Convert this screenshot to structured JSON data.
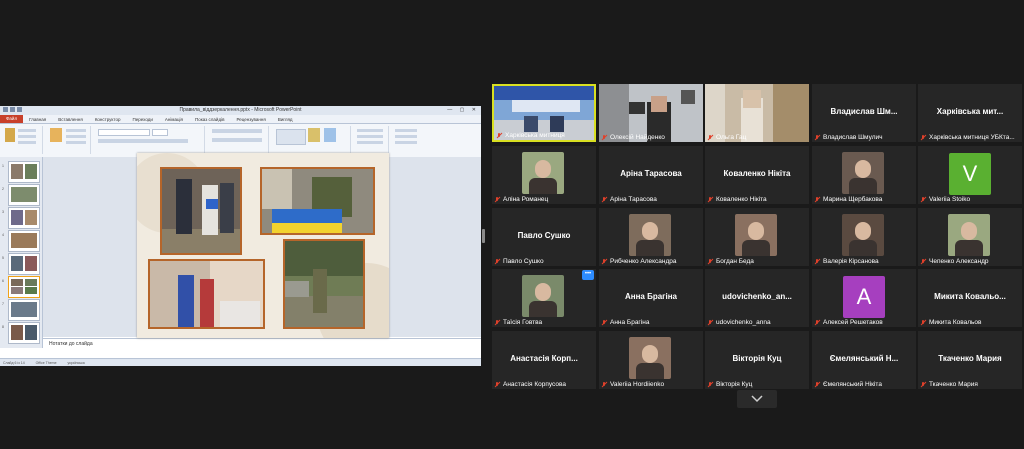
{
  "ppt": {
    "window_title": "Правила_віддзеркалення.pptx - Microsoft PowerPoint",
    "file_tab": "Файл",
    "ribbon_tabs": [
      "Главная",
      "Вставлення",
      "Конструктор",
      "Переходи",
      "Анімація",
      "Показ слайдів",
      "Рецензування",
      "Вигляд"
    ],
    "slide_numbers": [
      "1",
      "2",
      "3",
      "4",
      "5",
      "6",
      "7",
      "8"
    ],
    "notes_placeholder": "Нотатки до слайда",
    "status": [
      "Слайд 6 із 14",
      "Office Theme",
      "українська"
    ]
  },
  "participants": [
    {
      "id": "p1",
      "name": "Харківська митниця",
      "big": "",
      "kind": "video",
      "active": true
    },
    {
      "id": "p2",
      "name": "Олексій Найденко",
      "big": "",
      "kind": "video"
    },
    {
      "id": "p3",
      "name": "Ольга Гац",
      "big": "",
      "kind": "video"
    },
    {
      "id": "p4",
      "name": "Владислав Шмулич",
      "big": "Владислав Шм...",
      "kind": "text"
    },
    {
      "id": "p5",
      "name": "Харківська митниця УБКта...",
      "big": "Харківська мит...",
      "kind": "text"
    },
    {
      "id": "p6",
      "name": "Аліна Романец",
      "big": "",
      "kind": "avatar"
    },
    {
      "id": "p7",
      "name": "Аріна Тарасова",
      "big": "Аріна Тарасова",
      "kind": "text"
    },
    {
      "id": "p8",
      "name": "Коваленко Нікіта",
      "big": "Коваленко Нікіта",
      "kind": "text"
    },
    {
      "id": "p9",
      "name": "Марина Щербакова",
      "big": "",
      "kind": "avatar"
    },
    {
      "id": "p10",
      "name": "Valeriia Stoiko",
      "big": "",
      "kind": "letter",
      "letter": "V",
      "color": "#5ab031"
    },
    {
      "id": "p11",
      "name": "Павло Сушко",
      "big": "Павло Сушко",
      "kind": "text"
    },
    {
      "id": "p12",
      "name": "Рибченко Александра",
      "big": "",
      "kind": "avatar"
    },
    {
      "id": "p13",
      "name": "Богдан Беда",
      "big": "",
      "kind": "avatar"
    },
    {
      "id": "p14",
      "name": "Валерія Кірсанова",
      "big": "",
      "kind": "avatar"
    },
    {
      "id": "p15",
      "name": "Чепенко Александр",
      "big": "",
      "kind": "avatar"
    },
    {
      "id": "p16",
      "name": "Таїсія Говтва",
      "big": "",
      "kind": "avatar"
    },
    {
      "id": "p17",
      "name": "Анна Брагіна",
      "big": "Анна Брагіна",
      "kind": "text"
    },
    {
      "id": "p18",
      "name": "udovichenko_anna",
      "big": "udovichenko_an...",
      "kind": "text"
    },
    {
      "id": "p19",
      "name": "Алексей Решетаков",
      "big": "",
      "kind": "letter",
      "letter": "A",
      "color": "#a63fbf"
    },
    {
      "id": "p20",
      "name": "Микита Ковальов",
      "big": "Микита Ковальо...",
      "kind": "text"
    },
    {
      "id": "p21",
      "name": "Анастасія Корпусова",
      "big": "Анастасія Корп...",
      "kind": "text"
    },
    {
      "id": "p22",
      "name": "Valeriia Hordiienko",
      "big": "",
      "kind": "avatar"
    },
    {
      "id": "p23",
      "name": "Вікторія Куц",
      "big": "Вікторія Куц",
      "kind": "text"
    },
    {
      "id": "p24",
      "name": "Ємелянський Нікіта",
      "big": "Ємелянський Н...",
      "kind": "text"
    },
    {
      "id": "p25",
      "name": "Ткаченко Мария",
      "big": "Ткаченко Мария",
      "kind": "text"
    }
  ],
  "badge": "•••",
  "icons": {
    "mic_muted": "mic-muted-icon",
    "chevron": "chevron-down-icon"
  },
  "colors": {
    "bg": "#1a1a1a",
    "tile": "#262626",
    "active_border": "#d9e021",
    "muted": "#e0412b"
  }
}
